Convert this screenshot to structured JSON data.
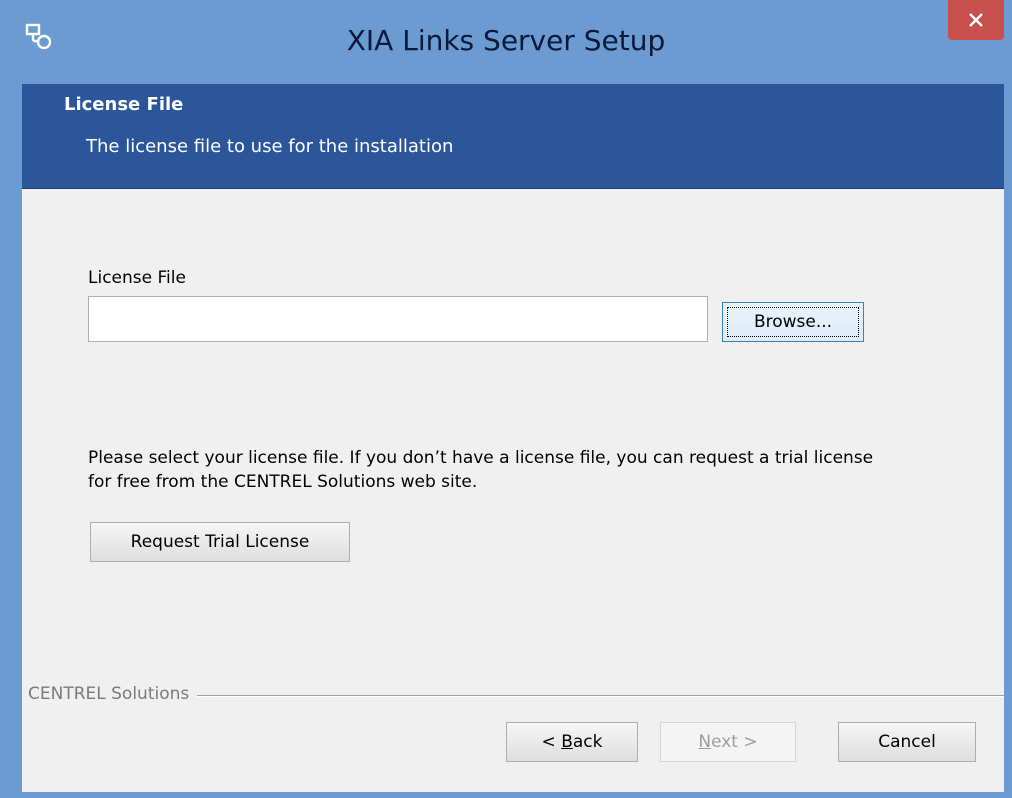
{
  "window": {
    "title": "XIA Links Server Setup"
  },
  "banner": {
    "title": "License File",
    "subtitle": "The license file to use for the installation"
  },
  "form": {
    "license_label": "License File",
    "license_value": "",
    "browse_label": "Browse..."
  },
  "info": {
    "message": "Please select your license file. If you don’t have a license file, you can request a trial license for free from the CENTREL Solutions web site."
  },
  "trial": {
    "label": "Request Trial License"
  },
  "footer": {
    "vendor": "CENTREL Solutions",
    "back_prefix": "< ",
    "back_key": "B",
    "back_rest": "ack",
    "next_key": "N",
    "next_rest": "ext >",
    "cancel_label": "Cancel"
  },
  "colors": {
    "titlebar": "#6b9bd1",
    "banner": "#2b579a",
    "close": "#c7504c",
    "client": "#f0f0f0"
  },
  "icons": {
    "app": "setup-app-icon",
    "close": "close-icon"
  }
}
